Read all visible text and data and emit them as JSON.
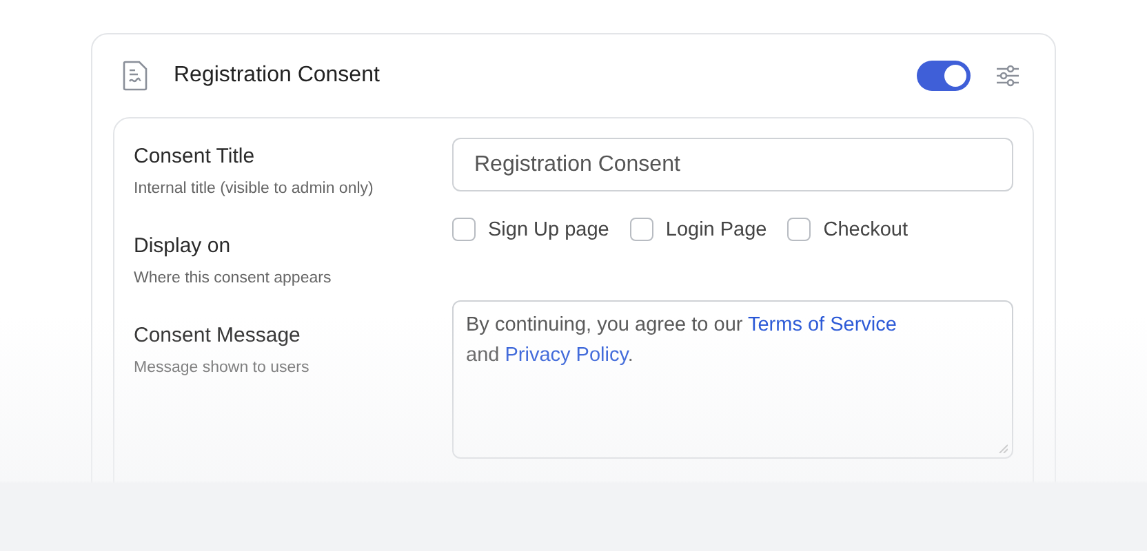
{
  "card": {
    "title": "Registration Consent",
    "enabled": true
  },
  "fields": [
    {
      "kind": "text",
      "label": "Consent Title",
      "hint": "Internal title (visible to admin only)",
      "value": "Registration Consent"
    },
    {
      "kind": "checks",
      "label": "Display on",
      "hint": "Where this consent appears",
      "options": [
        {
          "label": "Sign Up page",
          "checked": false
        },
        {
          "label": "Login Page",
          "checked": false
        },
        {
          "label": "Checkout",
          "checked": false
        }
      ]
    },
    {
      "kind": "message",
      "label": "Consent Message",
      "hint": "Message shown to users",
      "segments": [
        {
          "kind": "text",
          "text": "By continuing, you agree to our "
        },
        {
          "kind": "link",
          "text": "Terms of Service"
        },
        {
          "kind": "text",
          "text": " and "
        },
        {
          "kind": "link",
          "text": "Privacy Policy"
        },
        {
          "kind": "text",
          "text": "."
        }
      ]
    }
  ]
}
